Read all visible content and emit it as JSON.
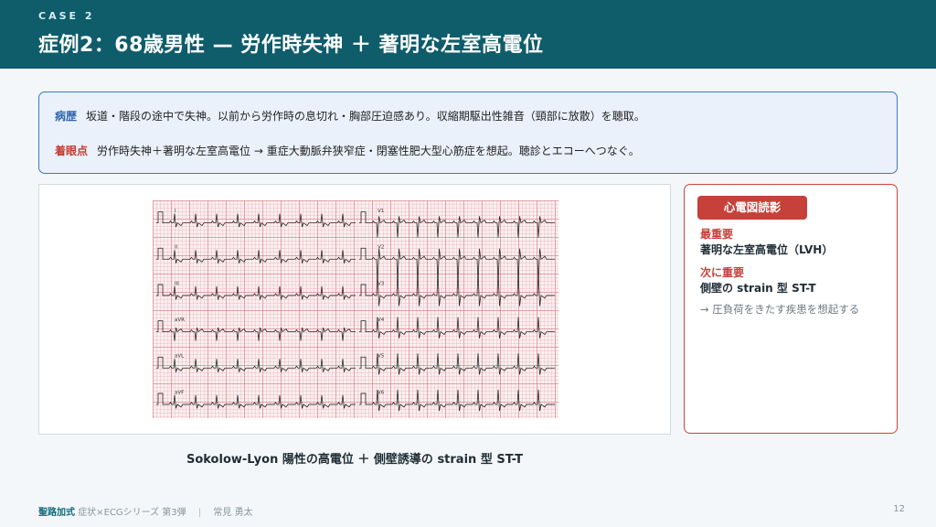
{
  "header": {
    "case_label": "CASE 2",
    "title": "症例2：68歳男性 — 労作時失神 ＋ 著明な左室高電位"
  },
  "history": {
    "history_tag": "病歴",
    "history_text": "坂道・階段の途中で失神。以前から労作時の息切れ・胸部圧迫感あり。収縮期駆出性雑音（頸部に放散）を聴取。",
    "focus_tag": "着眼点",
    "focus_text": "労作時失神＋著明な左室高電位 → 重症大動脈弁狭窄症・閉塞性肥大型心筋症を想起。聴診とエコーへつなぐ。"
  },
  "ecg": {
    "leads_left": [
      "I",
      "II",
      "III",
      "aVR",
      "aVL",
      "aVF"
    ],
    "leads_right": [
      "V1",
      "V2",
      "V3",
      "V4",
      "V5",
      "V6"
    ],
    "caption": "Sokolow-Lyon 陽性の高電位 ＋ 側壁誘導の strain 型 ST-T"
  },
  "reading": {
    "badge": "心電図読影",
    "most_important_label": "最重要",
    "most_important_text": "著明な左室高電位（LVH）",
    "second_label": "次に重要",
    "second_text": "側壁の strain 型 ST-T",
    "note": "→ 圧負荷をきたす疾患を想起する"
  },
  "footer": {
    "brand": "聖路加式",
    "series": "症状×ECGシリーズ 第3弾",
    "author": "常見 勇太",
    "page": "12"
  }
}
